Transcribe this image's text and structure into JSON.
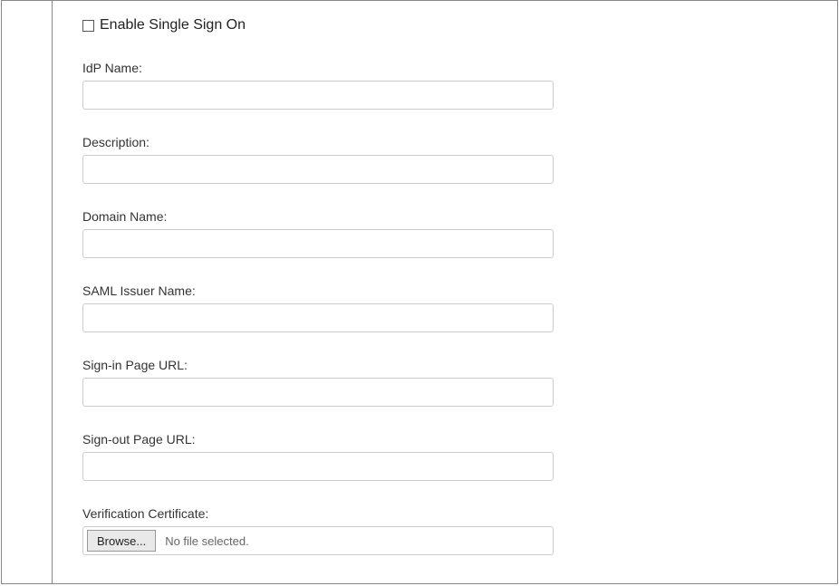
{
  "enableSSO": {
    "label": "Enable Single Sign On",
    "checked": false
  },
  "fields": {
    "idpName": {
      "label": "IdP Name:",
      "value": ""
    },
    "description": {
      "label": "Description:",
      "value": ""
    },
    "domainName": {
      "label": "Domain Name:",
      "value": ""
    },
    "samlIssuerName": {
      "label": "SAML Issuer Name:",
      "value": ""
    },
    "signInPageUrl": {
      "label": "Sign-in Page URL:",
      "value": ""
    },
    "signOutPageUrl": {
      "label": "Sign-out Page URL:",
      "value": ""
    },
    "verificationCertificate": {
      "label": "Verification Certificate:",
      "browseLabel": "Browse...",
      "fileStatus": "No file selected."
    }
  }
}
